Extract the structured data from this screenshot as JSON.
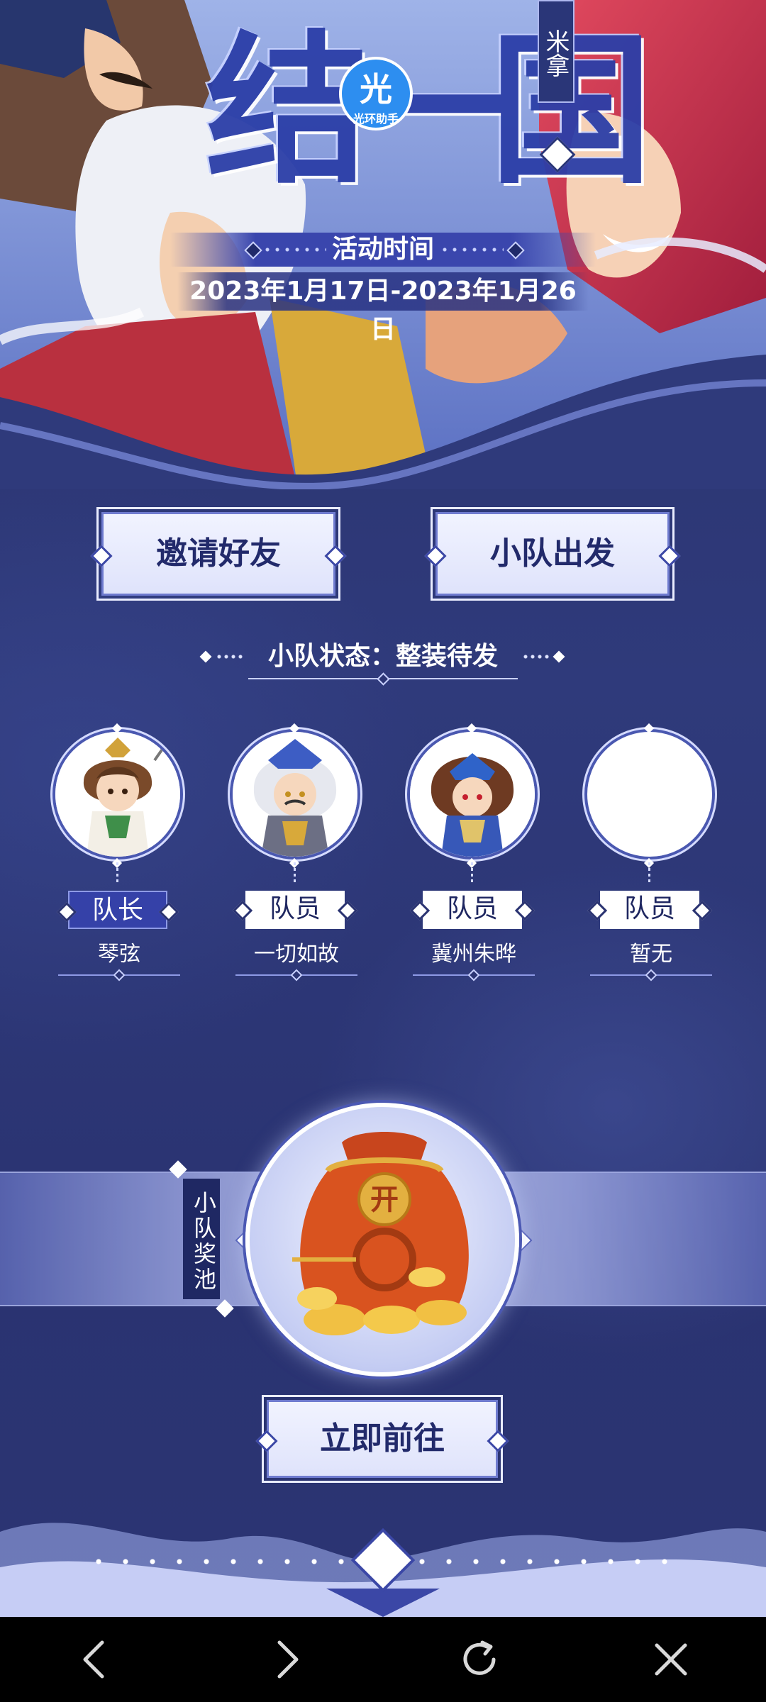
{
  "hero": {
    "title": "结一国",
    "side_tag": "米拿",
    "logo": {
      "glyph": "光",
      "text": "光环助手"
    },
    "time_label": "活动时间",
    "time_value": "2023年1月17日-2023年1月26日"
  },
  "actions": {
    "invite_label": "邀请好友",
    "depart_label": "小队出发",
    "go_label": "立即前往"
  },
  "squad": {
    "status_text": "小队状态：整装待发",
    "members": [
      {
        "role": "队长",
        "name": "琴弦"
      },
      {
        "role": "队员",
        "name": "一切如故"
      },
      {
        "role": "队员",
        "name": "冀州朱晔"
      },
      {
        "role": "队员",
        "name": "暂无"
      }
    ]
  },
  "prize_pool": {
    "label": "小队奖池",
    "bag_glyph": "开"
  },
  "navbar": {
    "items": [
      "back-icon",
      "forward-icon",
      "refresh-icon",
      "close-icon"
    ]
  },
  "colors": {
    "background": "#2b3470",
    "accent": "#3541a8",
    "button_text": "#222a6b",
    "navbar": "#000000"
  }
}
